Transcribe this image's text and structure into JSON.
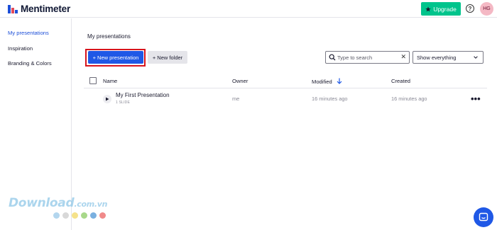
{
  "header": {
    "brand": "Mentimeter",
    "upgrade_label": "Upgrade",
    "help_glyph": "?",
    "avatar_initials": "HG",
    "colors": {
      "upgrade": "#00c48c",
      "avatar_bg": "#f4b8c4"
    }
  },
  "sidebar": {
    "items": [
      {
        "label": "My presentations",
        "active": true
      },
      {
        "label": "Inspiration",
        "active": false
      },
      {
        "label": "Branding & Colors",
        "active": false
      }
    ]
  },
  "main": {
    "title": "My presentations",
    "new_presentation_label": "+ New presentation",
    "new_folder_label": "+ New folder",
    "search": {
      "placeholder": "Type to search",
      "clear_glyph": "✕"
    },
    "filter": {
      "selected": "Show everything"
    },
    "table": {
      "columns": {
        "name": "Name",
        "owner": "Owner",
        "modified": "Modified",
        "created": "Created"
      },
      "sort": {
        "column": "modified",
        "direction": "desc"
      },
      "rows": [
        {
          "name": "My First Presentation",
          "sub": "1 SLIDE",
          "owner": "me",
          "modified": "16 minutes ago",
          "created": "16 minutes ago",
          "more": "•••"
        }
      ]
    }
  },
  "watermark": {
    "text": "Download",
    "suffix": ".com.vn",
    "dot_colors": [
      "#b3d6ee",
      "#d8d8d8",
      "#f5e28a",
      "#a8d88a",
      "#7ab0e0",
      "#f08a8a"
    ]
  },
  "colors": {
    "accent": "#1f58e6",
    "highlight_border": "#d7141d"
  }
}
